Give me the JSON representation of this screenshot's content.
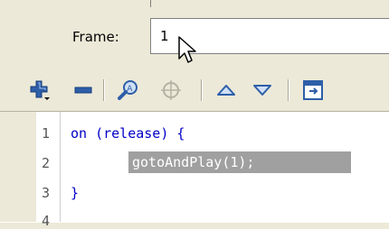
{
  "frame": {
    "label": "Frame:",
    "value": "1"
  },
  "toolbar": {
    "icons": [
      "add-action-icon",
      "remove-action-icon",
      "find-icon",
      "target-icon",
      "move-up-icon",
      "move-down-icon",
      "reference-icon"
    ]
  },
  "editor": {
    "line_numbers": [
      "1",
      "2",
      "3",
      "4"
    ],
    "line1_keyword": "on",
    "line1_rest": " (release) {",
    "line2_text": "gotoAndPlay(1);",
    "line3_text": "}"
  },
  "colors": {
    "background": "#ece9d8",
    "keyword": "#0000c8",
    "selection": "#a0a0a0",
    "icon_blue": "#2e5ea8"
  }
}
